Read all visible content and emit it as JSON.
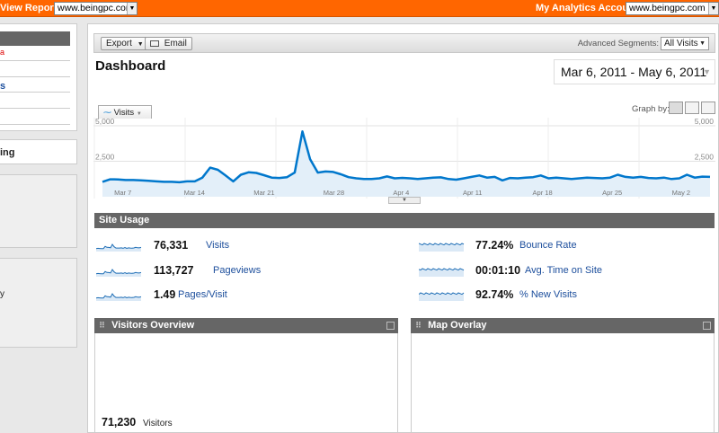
{
  "topbar": {
    "view_reports_label": "View Reports:",
    "view_reports_value": "www.beingpc.com",
    "accounts_label": "My Analytics Accounts:",
    "accounts_value": "www.beingpc.com"
  },
  "sidebar": {
    "fragment_red": "a",
    "fragment_blue": "s",
    "fragment_ing": "ing",
    "fragment_y": "y"
  },
  "toolbar": {
    "export_label": "Export",
    "email_label": "Email",
    "advanced_segments_label": "Advanced Segments:",
    "segment_value": "All Visits"
  },
  "page": {
    "title": "Dashboard",
    "date_range": "Mar 6, 2011 - May 6, 2011"
  },
  "graph": {
    "metric_tab": "Visits",
    "graph_by_label": "Graph by:"
  },
  "chart_data": {
    "type": "area",
    "series": [
      {
        "name": "Visits",
        "values": [
          1050,
          1230,
          1220,
          1180,
          1180,
          1150,
          1120,
          1080,
          1050,
          1050,
          1020,
          1080,
          1080,
          1350,
          2050,
          1900,
          1500,
          1080,
          1550,
          1720,
          1680,
          1520,
          1350,
          1320,
          1380,
          1700,
          4600,
          2650,
          1700,
          1780,
          1750,
          1580,
          1380,
          1300,
          1250,
          1250,
          1300,
          1430,
          1300,
          1330,
          1300,
          1250,
          1300,
          1350,
          1370,
          1250,
          1200,
          1300,
          1400,
          1500,
          1350,
          1400,
          1150,
          1320,
          1300,
          1350,
          1380,
          1500,
          1300,
          1350,
          1300,
          1250,
          1300,
          1350,
          1320,
          1300,
          1350,
          1550,
          1400,
          1350,
          1400,
          1320,
          1300,
          1350,
          1250,
          1300,
          1550,
          1350,
          1420,
          1400
        ]
      }
    ],
    "x_tick_labels": [
      "Mar 7",
      "Mar 14",
      "Mar 21",
      "Mar 28",
      "Apr 4",
      "Apr 11",
      "Apr 18",
      "Apr 25",
      "May 2"
    ],
    "y_tick_labels": [
      "5,000",
      "2,500"
    ],
    "ylim": [
      0,
      5000
    ],
    "grid": true,
    "line_color": "#0077cc",
    "fill_color": "#e3eff9"
  },
  "site_usage": {
    "header": "Site Usage",
    "metrics_left": [
      {
        "value": "76,331",
        "name": "Visits"
      },
      {
        "value": "113,727",
        "name": "Pageviews"
      },
      {
        "value": "1.49",
        "name": "Pages/Visit"
      }
    ],
    "metrics_right": [
      {
        "value": "77.24%",
        "name": "Bounce Rate"
      },
      {
        "value": "00:01:10",
        "name": "Avg. Time on Site"
      },
      {
        "value": "92.74%",
        "name": "% New Visits"
      }
    ]
  },
  "visitors_overview": {
    "header": "Visitors Overview",
    "visitors_value": "71,230",
    "visitors_label": "Visitors"
  },
  "map_overlay": {
    "header": "Map Overlay"
  }
}
